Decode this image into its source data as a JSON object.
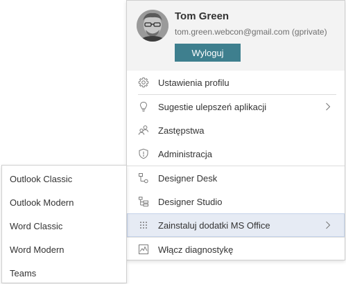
{
  "profile": {
    "name": "Tom Green",
    "email": "tom.green.webcon@gmail.com (gprivate)",
    "logout_label": "Wyloguj"
  },
  "menu": {
    "items": [
      {
        "label": "Ustawienia profilu",
        "icon": "gear-icon"
      },
      {
        "label": "Sugestie ulepszeń aplikacji",
        "icon": "lightbulb-icon",
        "has_submenu": true
      },
      {
        "label": "Zastępstwa",
        "icon": "users-icon"
      },
      {
        "label": "Administracja",
        "icon": "shield-icon"
      },
      {
        "label": "Designer Desk",
        "icon": "flow-icon"
      },
      {
        "label": "Designer Studio",
        "icon": "studio-icon"
      },
      {
        "label": "Zainstaluj dodatki MS Office",
        "icon": "grid-dots-icon",
        "has_submenu": true,
        "active": true
      },
      {
        "label": "Włącz diagnostykę",
        "icon": "chart-icon"
      }
    ]
  },
  "submenu": {
    "items": [
      {
        "label": "Outlook Classic"
      },
      {
        "label": "Outlook Modern"
      },
      {
        "label": "Word Classic"
      },
      {
        "label": "Word Modern"
      },
      {
        "label": "Teams"
      }
    ]
  },
  "colors": {
    "accent": "#3e7f8e",
    "header_bg": "#f3f3f3",
    "active_bg": "#e6ebf4",
    "active_border": "#c4d2ea",
    "icon": "#7a7a7a"
  }
}
